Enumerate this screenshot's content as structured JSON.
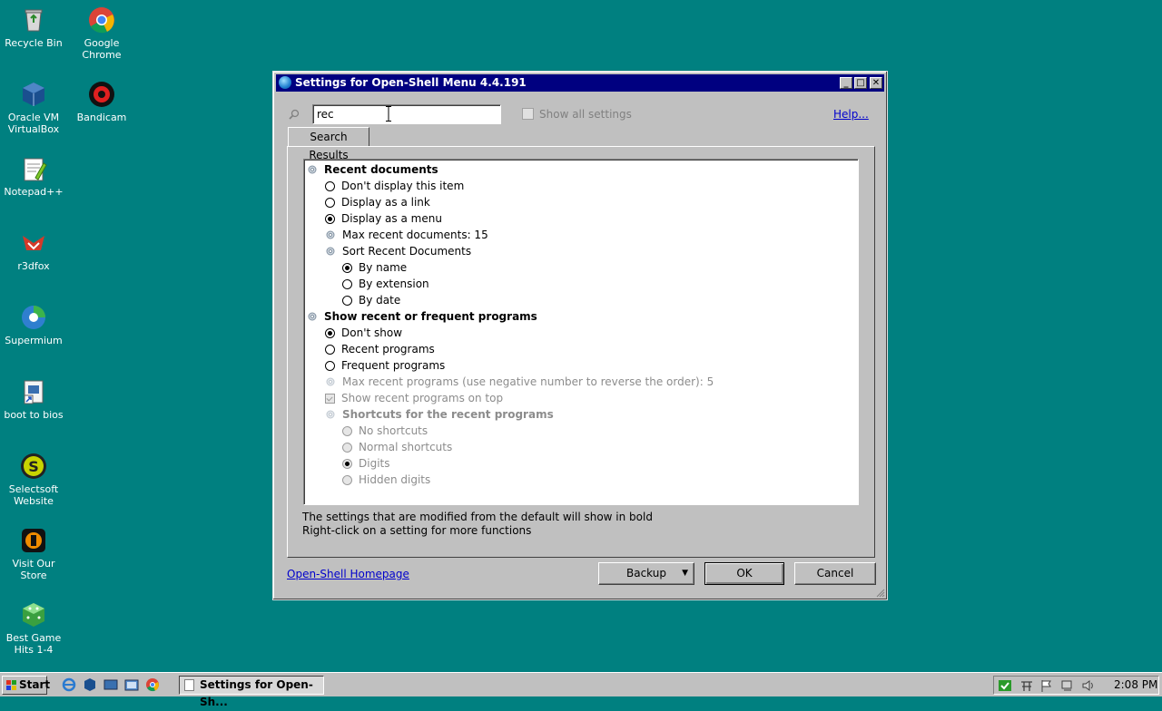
{
  "desktop": {
    "icons": [
      {
        "label": "Recycle Bin",
        "icon": "recycle-bin-icon"
      },
      {
        "label": "Google Chrome",
        "icon": "chrome-icon"
      },
      {
        "label": "Oracle VM VirtualBox",
        "icon": "virtualbox-icon"
      },
      {
        "label": "Bandicam",
        "icon": "bandicam-icon"
      },
      {
        "label": "Notepad++",
        "icon": "notepadpp-icon"
      },
      {
        "label": "r3dfox",
        "icon": "r3dfox-icon"
      },
      {
        "label": "Supermium",
        "icon": "supermium-icon"
      },
      {
        "label": "boot to bios",
        "icon": "shortcut-icon"
      },
      {
        "label": "Selectsoft Website",
        "icon": "selectsoft-icon"
      },
      {
        "label": "Visit Our Store",
        "icon": "store-icon"
      },
      {
        "label": "Best Game Hits 1-4",
        "icon": "game-icon"
      }
    ]
  },
  "dialog": {
    "title": "Settings for Open-Shell Menu 4.4.191",
    "search_value": "rec",
    "show_all_label": "Show all settings",
    "help_link": "Help...",
    "tab_label": "Search Results",
    "tree": [
      {
        "kind": "group",
        "label": "Recent documents",
        "bold": true,
        "disabled": false
      },
      {
        "kind": "radio",
        "label": "Don't display this item",
        "checked": false,
        "disabled": false
      },
      {
        "kind": "radio",
        "label": "Display as a link",
        "checked": false,
        "disabled": false
      },
      {
        "kind": "radio",
        "label": "Display as a menu",
        "checked": true,
        "disabled": false
      },
      {
        "kind": "setting",
        "label": "Max recent documents: 15",
        "disabled": false
      },
      {
        "kind": "setting",
        "label": "Sort Recent Documents",
        "disabled": false
      },
      {
        "kind": "radio",
        "label": "By name",
        "checked": true,
        "disabled": false
      },
      {
        "kind": "radio",
        "label": "By extension",
        "checked": false,
        "disabled": false
      },
      {
        "kind": "radio",
        "label": "By date",
        "checked": false,
        "disabled": false
      },
      {
        "kind": "group",
        "label": "Show recent or frequent programs",
        "bold": true,
        "disabled": false
      },
      {
        "kind": "radio",
        "label": "Don't show",
        "checked": true,
        "disabled": false
      },
      {
        "kind": "radio",
        "label": "Recent programs",
        "checked": false,
        "disabled": false
      },
      {
        "kind": "radio",
        "label": "Frequent programs",
        "checked": false,
        "disabled": false
      },
      {
        "kind": "setting",
        "label": "Max recent programs (use negative number to reverse the order): 5",
        "disabled": true
      },
      {
        "kind": "checkbox",
        "label": "Show recent programs on top",
        "checked": true,
        "disabled": true
      },
      {
        "kind": "setting",
        "label": "Shortcuts for the recent programs",
        "bold": true,
        "disabled": true
      },
      {
        "kind": "radio",
        "label": "No shortcuts",
        "checked": false,
        "disabled": true
      },
      {
        "kind": "radio",
        "label": "Normal shortcuts",
        "checked": false,
        "disabled": true
      },
      {
        "kind": "radio",
        "label": "Digits",
        "checked": true,
        "disabled": true
      },
      {
        "kind": "radio",
        "label": "Hidden digits",
        "checked": false,
        "disabled": true
      }
    ],
    "hint_line1": "The settings that are modified from the default will show in bold",
    "hint_line2": "Right-click on a setting for more functions",
    "homepage_link": "Open-Shell Homepage",
    "backup_label": "Backup",
    "ok_label": "OK",
    "cancel_label": "Cancel"
  },
  "taskbar": {
    "start_label": "Start",
    "task_label": "Settings for Open-Sh...",
    "clock": "2:08 PM"
  },
  "colors": {
    "desktop": "#008080",
    "titlebar": "#000080",
    "link": "#0000cc"
  }
}
